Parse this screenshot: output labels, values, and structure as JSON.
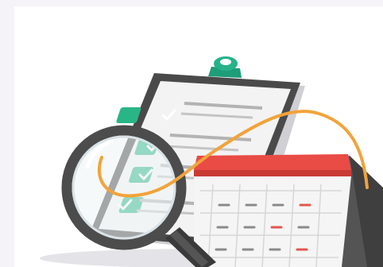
{
  "illustration": {
    "clipboard_check_rows": 4,
    "calendar_rows": 3,
    "calendar_columns": 5,
    "colors": {
      "canvas_outer": "#f5f2f8",
      "canvas_inner": "#ffffff",
      "clip": "#26b28a",
      "clipboard_frame": "#4a4a4a",
      "paper": "#f2f2f2",
      "check_box": "#29b686",
      "text_lines": "#b0b0b0",
      "calendar_header": "#e94b45",
      "calendar_body": "#f5f5f5",
      "calendar_back": "#525252",
      "grid_lines": "#d4d4d4",
      "dash_dark": "#8a8a8a",
      "dash_red": "#e25650",
      "magnifier_rim": "#4c4c4c",
      "lens": "#eef4f6",
      "handle": "#3a3a3a",
      "curve": "#f2a33a",
      "shadow": "#d8d8dc"
    },
    "icons": [
      "clipboard-icon",
      "check-icon",
      "calendar-icon",
      "magnifier-icon"
    ]
  }
}
